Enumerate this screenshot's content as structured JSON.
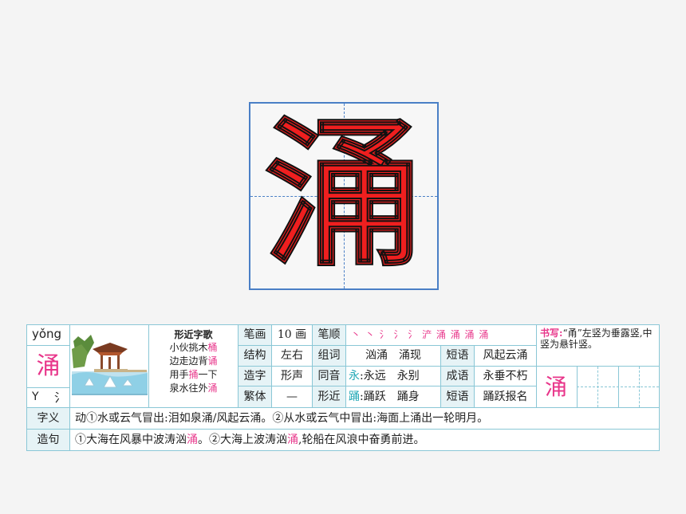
{
  "main_character": "涌",
  "card": {
    "pinyin": "yǒng",
    "character": "涌",
    "radical_label": "Y",
    "radical": "氵",
    "song": {
      "title": "形近字歌",
      "lines": [
        [
          {
            "t": "小伙挑木"
          },
          {
            "t": "桶",
            "c": "pink"
          }
        ],
        [
          {
            "t": "边走边背"
          },
          {
            "t": "诵",
            "c": "pink"
          }
        ],
        [
          {
            "t": "用手"
          },
          {
            "t": "捅",
            "c": "pink"
          },
          {
            "t": "一下"
          }
        ],
        [
          {
            "t": "泉水往外"
          },
          {
            "t": "涌",
            "c": "pink"
          }
        ]
      ]
    },
    "labels": {
      "strokes": "笔画",
      "order": "笔顺",
      "structure": "结构",
      "words": "组词",
      "phrase1": "短语",
      "formation": "造字",
      "homophone": "同音",
      "idiom": "成语",
      "traditional": "繁体",
      "similar": "形近",
      "phrase2": "短语",
      "meaning": "字义",
      "sentence": "造句"
    },
    "values": {
      "strokes": "10 画",
      "stroke_order": "丶 丶 氵 氵 氵 浐 涌 涌 涌 涌",
      "structure": "左右",
      "words": "汹涌　涌现",
      "phrase1": "风起云涌",
      "formation": "形声",
      "homophone_char": "永",
      "homophone_words": ":永远　永别",
      "idiom": "永垂不朽",
      "traditional": "—",
      "similar_char": "踊",
      "similar_words": ":踊跃　踊身",
      "phrase2": "踊跃报名"
    },
    "writing_note": {
      "label": "书写:",
      "text": "“甬”左竖为垂露竖,中竖为悬针竖。"
    },
    "practice_char": "涌",
    "meaning": "动①水或云气冒出:泪如泉涌/风起云涌。②从水或云气中冒出:海面上涌出一轮明月。",
    "sentence": [
      {
        "t": "①大海在风暴中波涛汹"
      },
      {
        "t": "涌",
        "c": "pink"
      },
      {
        "t": "。②大海上波涛汹"
      },
      {
        "t": "涌",
        "c": "pink"
      },
      {
        "t": ",轮船在风浪中奋勇前进。"
      }
    ]
  }
}
